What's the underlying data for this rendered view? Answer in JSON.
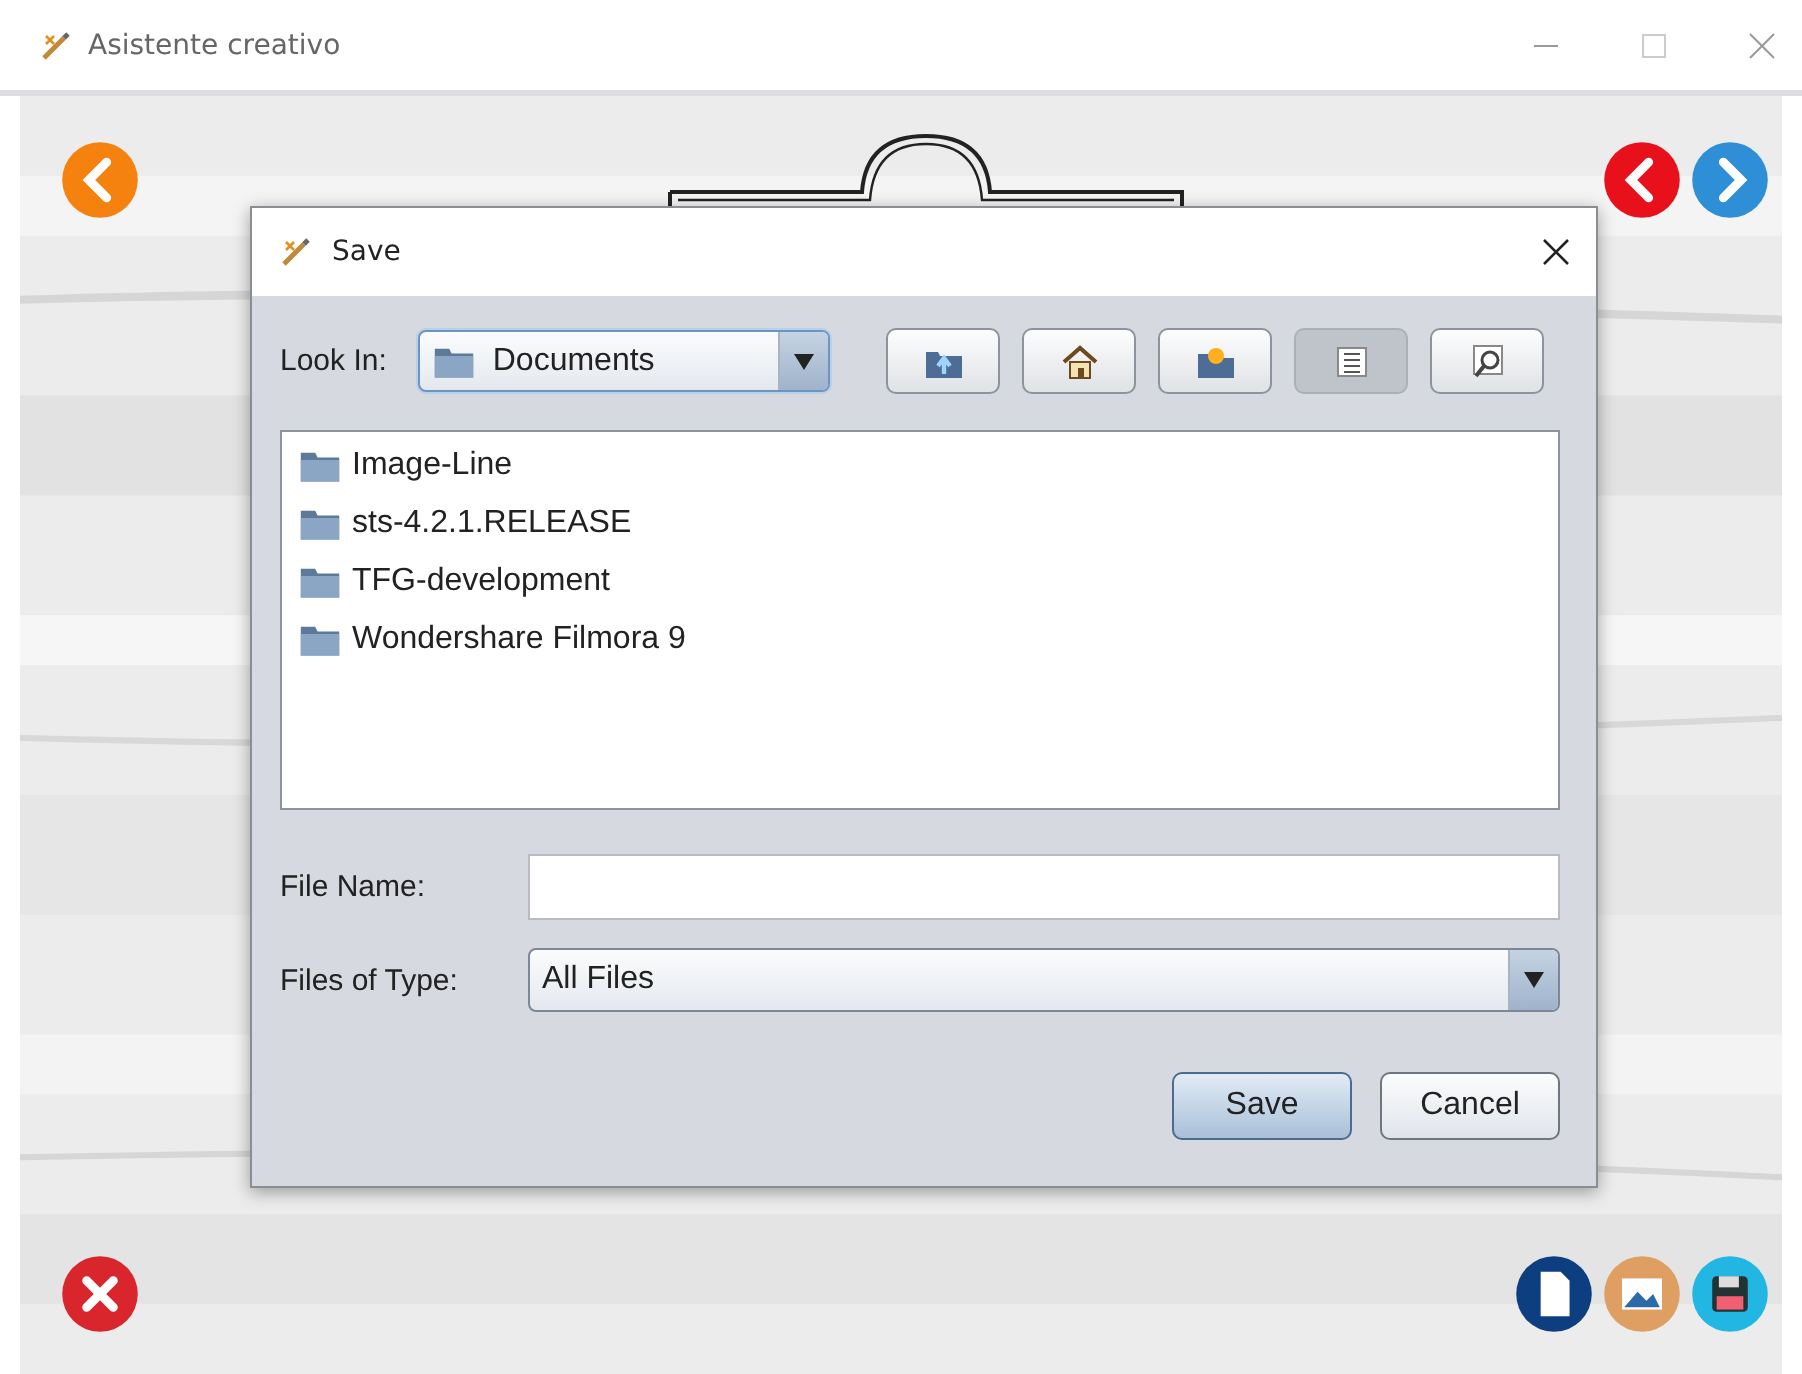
{
  "window": {
    "title": "Asistente creativo"
  },
  "dialog": {
    "title": "Save",
    "look_in": {
      "label": "Look In:",
      "value": "Documents"
    },
    "toolbar": [
      {
        "kind": "up",
        "selected": false
      },
      {
        "kind": "home",
        "selected": false
      },
      {
        "kind": "new-folder",
        "selected": false
      },
      {
        "kind": "list",
        "selected": true
      },
      {
        "kind": "details",
        "selected": false
      }
    ],
    "files": [
      {
        "name": "Image-Line"
      },
      {
        "name": "sts-4.2.1.RELEASE"
      },
      {
        "name": "TFG-development"
      },
      {
        "name": "Wondershare Filmora 9"
      }
    ],
    "file_name": {
      "label": "File Name:"
    },
    "file_type": {
      "label": "Files of Type:",
      "value": "All Files"
    },
    "buttons": [
      {
        "label": "Save",
        "kind": "primary"
      },
      {
        "label": "Cancel",
        "kind": "normal"
      }
    ]
  }
}
